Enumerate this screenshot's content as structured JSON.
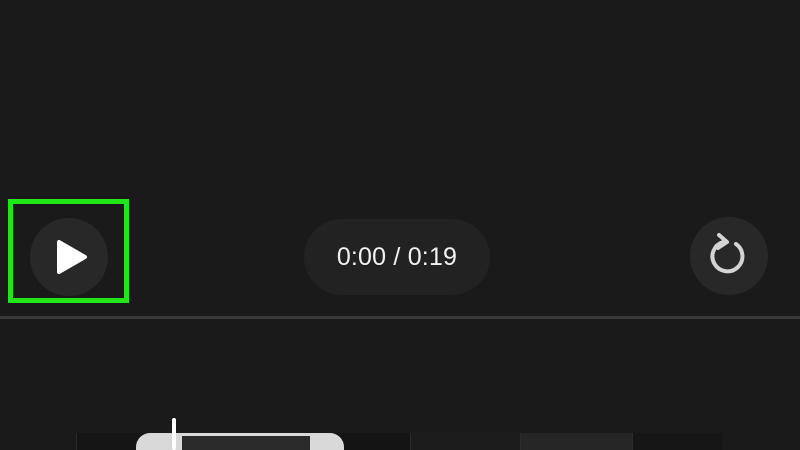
{
  "player": {
    "time_display": "0:00 / 0:19",
    "play_icon": "play-icon",
    "replay_icon": "replay-icon",
    "highlight_color": "#22e51a"
  },
  "timeline": {
    "playhead_position": 0.0
  }
}
